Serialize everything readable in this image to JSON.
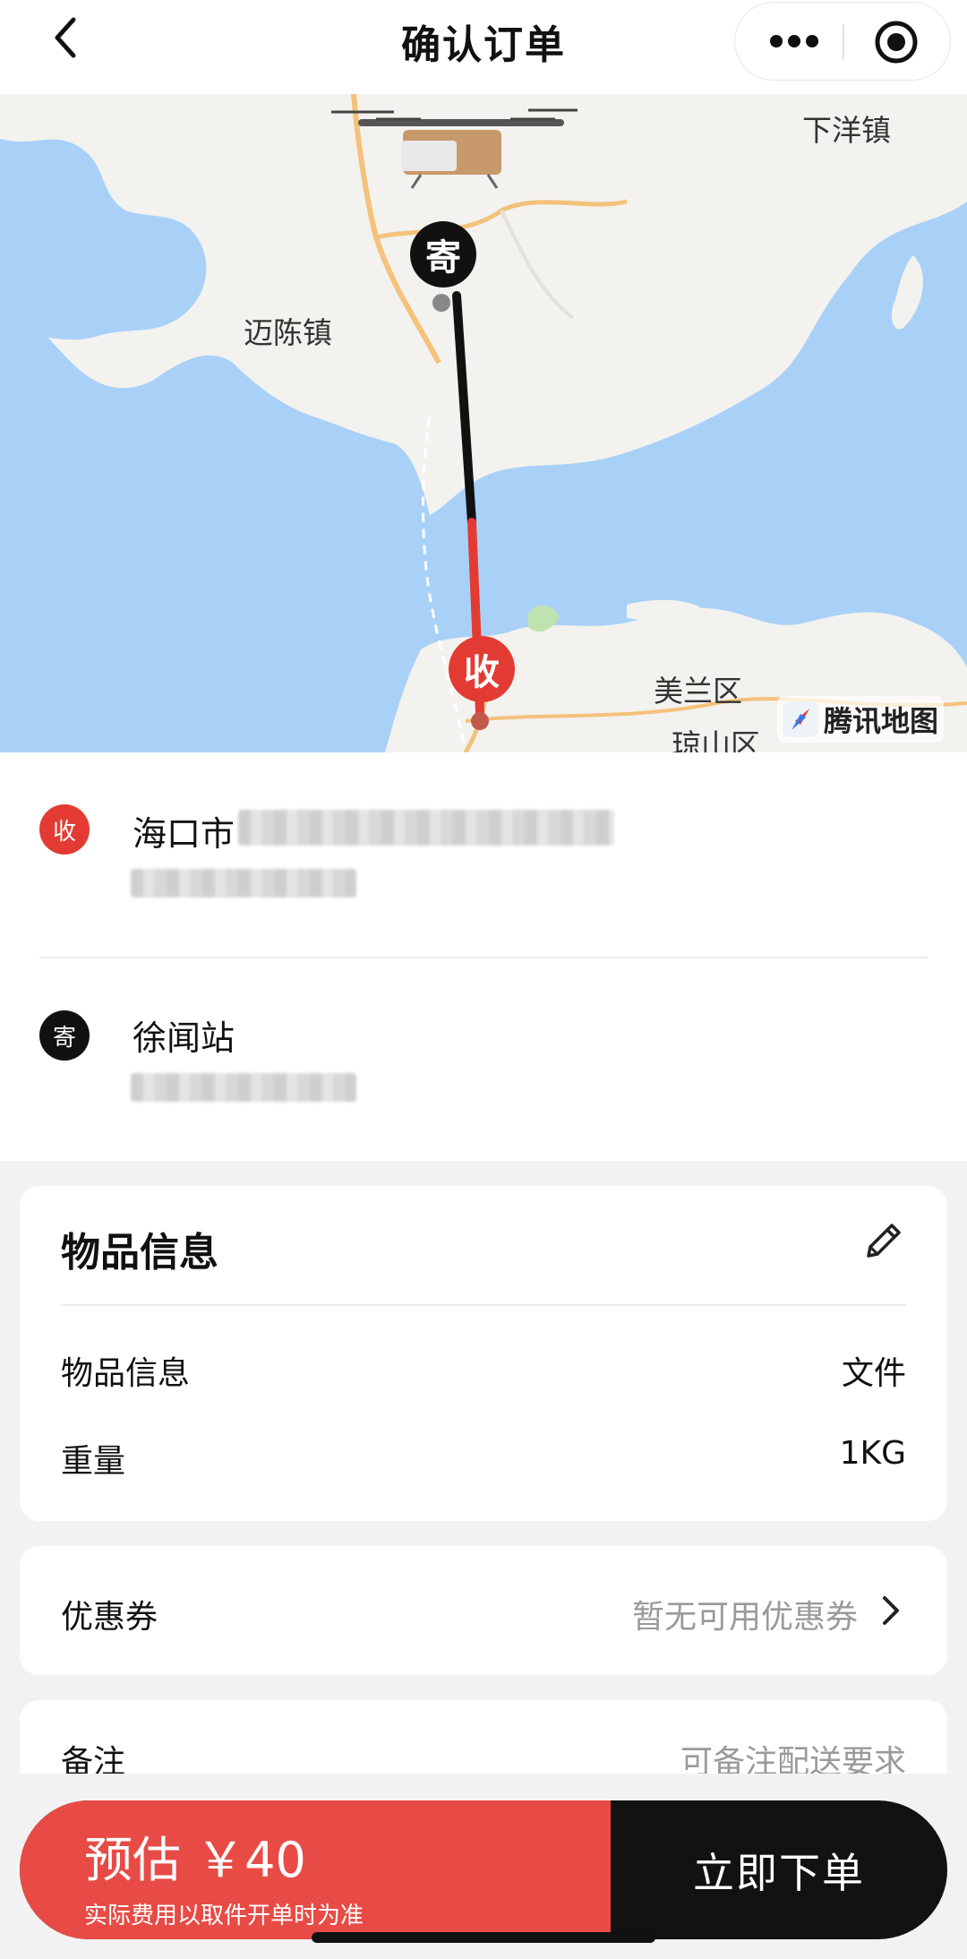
{
  "header": {
    "title": "确认订单",
    "back_icon": "chevron-left-icon",
    "more_icon": "more-dots-icon",
    "capsule_close_icon": "target-circle-icon"
  },
  "map": {
    "labels": {
      "xiayang": "下洋镇",
      "maichen": "迈陈镇",
      "meilan": "美兰区",
      "qiongshan": "琼山区"
    },
    "send_pin": "寄",
    "recv_pin": "收",
    "provider": "腾讯地图",
    "colors": {
      "water": "#a9d1f7",
      "land": "#f3f2ee",
      "route_send": "#111111",
      "route_recv": "#e33b33"
    }
  },
  "addresses": {
    "receiver": {
      "badge": "收",
      "name": "海口市"
    },
    "sender": {
      "badge": "寄",
      "name": "徐闻站"
    }
  },
  "goods": {
    "title": "物品信息",
    "rows": [
      {
        "label": "物品信息",
        "value": "文件"
      },
      {
        "label": "重量",
        "value": "1KG"
      }
    ]
  },
  "coupon": {
    "label": "优惠券",
    "value": "暂无可用优惠券"
  },
  "remark": {
    "label": "备注",
    "placeholder": "可备注配送要求"
  },
  "bottom": {
    "price": "预估 ￥40",
    "note": "实际费用以取件开单时为准",
    "submit": "立即下单",
    "accent": "#e84b45"
  }
}
